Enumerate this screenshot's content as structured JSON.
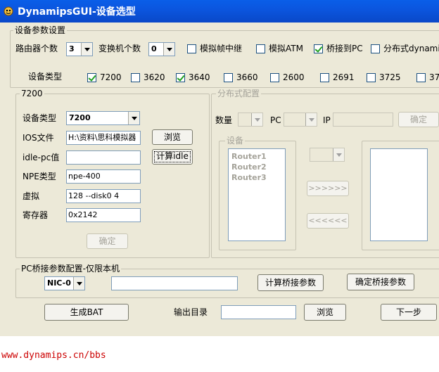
{
  "window": {
    "title": "DynamipsGUI-设备选型"
  },
  "params": {
    "legend": "设备参数设置",
    "router_count_label": "路由器个数",
    "router_count_value": "3",
    "switch_count_label": "变换机个数",
    "switch_count_value": "0",
    "frame_relay_label": "模拟帧中继",
    "atm_label": "模拟ATM",
    "bridge_pc_label": "桥接到PC",
    "distributed_label": "分布式dynamip",
    "device_type_label": "设备类型",
    "types": [
      {
        "label": "7200",
        "checked": true
      },
      {
        "label": "3620",
        "checked": false
      },
      {
        "label": "3640",
        "checked": true
      },
      {
        "label": "3660",
        "checked": false
      },
      {
        "label": "2600",
        "checked": false
      },
      {
        "label": "2691",
        "checked": false
      },
      {
        "label": "3725",
        "checked": false
      },
      {
        "label": "37",
        "checked": false
      }
    ]
  },
  "g7200": {
    "legend": "7200",
    "device_type_label": "设备类型",
    "device_type_value": "7200",
    "ios_label": "IOS文件",
    "ios_value": "H:\\资料\\思科模拟器",
    "browse": "浏览",
    "idle_label": "idle-pc值",
    "idle_value": "",
    "calc_idle": "计算idle",
    "npe_label": "NPE类型",
    "npe_value": "npe-400",
    "virtual_label": "虚拟",
    "virtual_value": "128 --disk0 4",
    "register_label": "寄存器",
    "register_value": "0x2142",
    "ok": "确定"
  },
  "dist": {
    "legend": "分布式配置",
    "count_label": "数量",
    "pc_label": "PC",
    "ip_label": "IP",
    "ok": "确定",
    "devices_legend": "设备",
    "devices": [
      "Router1",
      "Router2",
      "Router3"
    ],
    "move_right": ">>>>>>",
    "move_left": "<<<<<<"
  },
  "bridge": {
    "legend": "PC桥接参数配置-仅限本机",
    "nic_value": "NIC-0",
    "calc": "计算桥接参数",
    "confirm": "确定桥接参数"
  },
  "bottom": {
    "gen_bat": "生成BAT",
    "output_dir_label": "输出目录",
    "browse": "浏览",
    "next": "下一步"
  },
  "footer": {
    "url": "www.dynamips.cn/bbs"
  }
}
